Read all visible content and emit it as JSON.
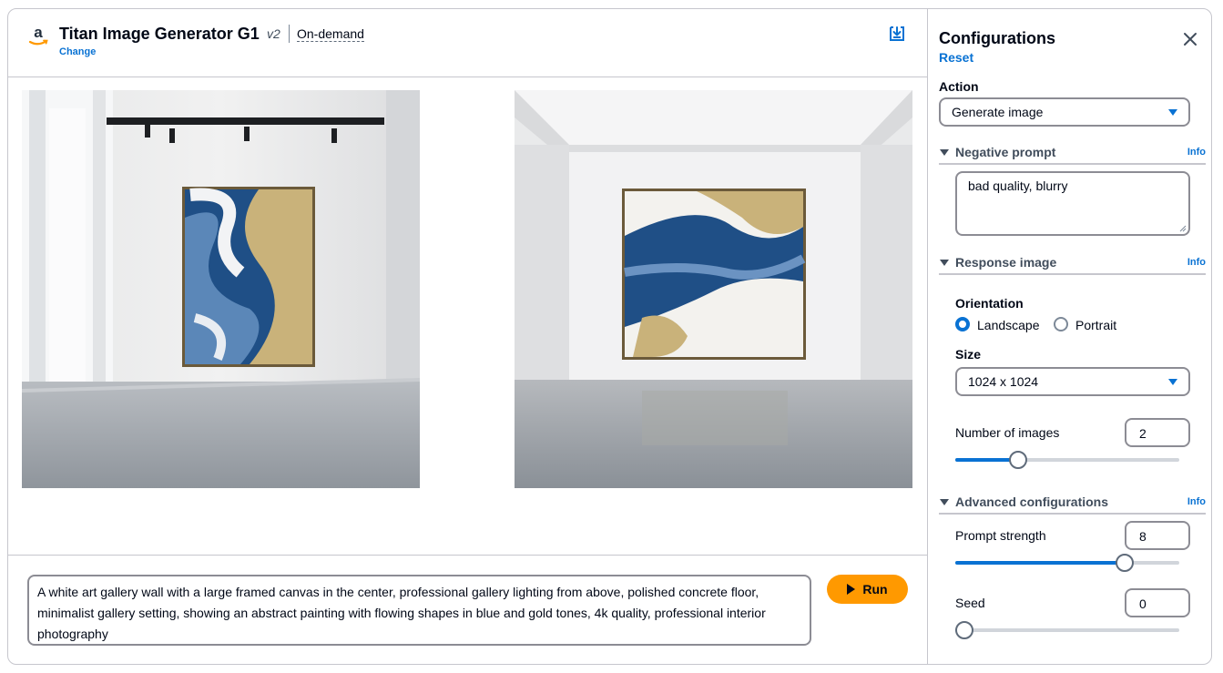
{
  "header": {
    "model_name": "Titan Image Generator G1",
    "model_version": "v2",
    "pricing": "On-demand",
    "change_label": "Change"
  },
  "prompt": {
    "text": "A white art gallery wall with a large framed canvas in the center, professional gallery lighting from above, polished concrete floor, minimalist gallery setting, showing an abstract painting with flowing shapes in blue and gold tones, 4k quality, professional interior photography",
    "run_label": "Run"
  },
  "panel": {
    "title": "Configurations",
    "reset_label": "Reset",
    "action_label": "Action",
    "action_value": "Generate image",
    "negative_prompt": {
      "label": "Negative prompt",
      "info": "Info",
      "value": "bad quality, blurry"
    },
    "response_image": {
      "label": "Response image",
      "info": "Info",
      "orientation_label": "Orientation",
      "orientation_options": [
        "Landscape",
        "Portrait"
      ],
      "orientation_selected": "Landscape",
      "size_label": "Size",
      "size_value": "1024 x 1024",
      "num_images_label": "Number of images",
      "num_images_value": "2",
      "num_images_fraction": 0.26
    },
    "advanced": {
      "label": "Advanced configurations",
      "info": "Info",
      "prompt_strength_label": "Prompt strength",
      "prompt_strength_value": "8",
      "prompt_strength_fraction": 0.78,
      "seed_label": "Seed",
      "seed_value": "0",
      "seed_fraction": 0.0
    }
  },
  "colors": {
    "accent": "#0972d3",
    "run_button": "#ff9900",
    "border": "#c6c6cd"
  },
  "icons": {
    "logo": "amazon-logo-icon",
    "download": "download-icon",
    "close": "close-icon",
    "run": "play-icon"
  }
}
